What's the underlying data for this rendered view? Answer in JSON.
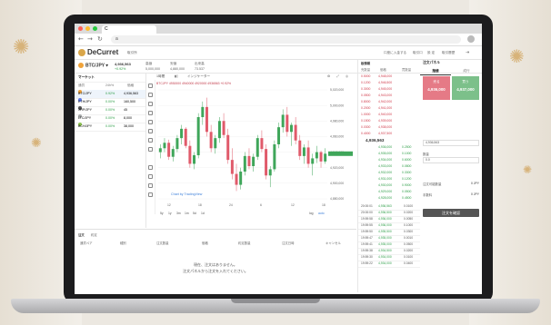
{
  "browser": {
    "tab_title": "C",
    "url": "a"
  },
  "app": {
    "logo": "DeCurret",
    "header_tag": "取引所",
    "header_right": [
      "口座に入金する",
      "取引口",
      "設 定",
      "取引履歴"
    ]
  },
  "ticker": {
    "pair": "BTC/JPY",
    "last_price": "4,936,563",
    "change_pct": "+0.92%",
    "high": "5,000,000",
    "low": "4,880,000",
    "volume": "73.537"
  },
  "left_panel": {
    "title": "マーケット",
    "headers": [
      "通貨",
      "24h%",
      "価格"
    ],
    "rows": [
      {
        "pair": "BTC/JPY",
        "change": "0.92%",
        "price": "4,936,563",
        "color": "#f0a33a"
      },
      {
        "pair": "ETH/JPY",
        "change": "0.00%",
        "price": "160,500",
        "color": "#627eea"
      },
      {
        "pair": "XRP/JPY",
        "change": "0.00%",
        "price": "45",
        "color": "#555555"
      },
      {
        "pair": "LTC/JPY",
        "change": "0.00%",
        "price": "8,000",
        "color": "#a6a9aa"
      },
      {
        "pair": "BCH/JPY",
        "change": "0.00%",
        "price": "38,000",
        "color": "#8dc351"
      }
    ]
  },
  "chart": {
    "interval_label": "1時間",
    "indicator_label": "インジケーター",
    "ohlc_text": "BTCJPY 4930000 4940000 4920000 4936563 +0.92%",
    "watermark": "Chart by TradingView",
    "time_ranges": [
      "5y",
      "1y",
      "3m",
      "1m",
      "5d",
      "1d"
    ],
    "log_label": "log",
    "auto_label": "auto",
    "time_ticks": [
      "12",
      "18",
      "24",
      "6",
      "12",
      "18"
    ],
    "price_ticks": [
      "5,020,000",
      "5,000,000",
      "4,980,000",
      "4,960,000",
      "4,940,000",
      "4,920,000",
      "4,900,000",
      "4,880,000"
    ]
  },
  "chart_data": {
    "type": "candlestick",
    "title": "",
    "ylim": [
      4880000,
      5020000
    ],
    "candles": [
      [
        4940000,
        4950000,
        4932000,
        4945000
      ],
      [
        4945000,
        4958000,
        4940000,
        4952000
      ],
      [
        4952000,
        4956000,
        4930000,
        4934000
      ],
      [
        4934000,
        4948000,
        4928000,
        4944000
      ],
      [
        4944000,
        4962000,
        4940000,
        4958000
      ],
      [
        4958000,
        4975000,
        4950000,
        4970000
      ],
      [
        4970000,
        4972000,
        4945000,
        4948000
      ],
      [
        4948000,
        4955000,
        4920000,
        4925000
      ],
      [
        4925000,
        4940000,
        4918000,
        4936000
      ],
      [
        4936000,
        4990000,
        4932000,
        4985000
      ],
      [
        4985000,
        5005000,
        4975000,
        4998000
      ],
      [
        4998000,
        5010000,
        4960000,
        4966000
      ],
      [
        4966000,
        4975000,
        4940000,
        4945000
      ],
      [
        4945000,
        4962000,
        4938000,
        4958000
      ],
      [
        4958000,
        4985000,
        4952000,
        4980000
      ],
      [
        4980000,
        4990000,
        4958000,
        4962000
      ],
      [
        4962000,
        4970000,
        4925000,
        4930000
      ],
      [
        4930000,
        4945000,
        4905000,
        4912000
      ],
      [
        4912000,
        4925000,
        4890000,
        4898000
      ],
      [
        4898000,
        4920000,
        4892000,
        4915000
      ],
      [
        4915000,
        4940000,
        4910000,
        4935000
      ],
      [
        4935000,
        4945000,
        4918000,
        4922000
      ],
      [
        4922000,
        4938000,
        4915000,
        4934000
      ],
      [
        4934000,
        4962000,
        4930000,
        4958000
      ],
      [
        4958000,
        4968000,
        4940000,
        4944000
      ],
      [
        4944000,
        4950000,
        4905000,
        4910000
      ],
      [
        4910000,
        4922000,
        4895000,
        4918000
      ],
      [
        4918000,
        4955000,
        4915000,
        4950000
      ],
      [
        4950000,
        4978000,
        4945000,
        4972000
      ],
      [
        4972000,
        4995000,
        4965000,
        4988000
      ],
      [
        4988000,
        4998000,
        4960000,
        4966000
      ],
      [
        4966000,
        4978000,
        4948000,
        4975000
      ],
      [
        4975000,
        4985000,
        4950000,
        4955000
      ],
      [
        4955000,
        4962000,
        4930000,
        4935000
      ],
      [
        4935000,
        4950000,
        4925000,
        4946000
      ],
      [
        4946000,
        4955000,
        4920000,
        4925000
      ],
      [
        4925000,
        4938000,
        4910000,
        4932000
      ],
      [
        4932000,
        4948000,
        4926000,
        4940000
      ],
      [
        4940000,
        4942000,
        4920000,
        4928000
      ],
      [
        4928000,
        4945000,
        4925000,
        4938000
      ]
    ]
  },
  "orderbook": {
    "title": "板情報",
    "headers": [
      "売数量",
      "価格",
      "買数量"
    ],
    "asks": [
      {
        "qty": "0.5000",
        "price": "4,948,000"
      },
      {
        "qty": "0.1200",
        "price": "4,946,500"
      },
      {
        "qty": "0.3000",
        "price": "4,945,000"
      },
      {
        "qty": "0.0500",
        "price": "4,943,000"
      },
      {
        "qty": "0.8000",
        "price": "4,942,000"
      },
      {
        "qty": "0.2000",
        "price": "4,941,000"
      },
      {
        "qty": "1.0000",
        "price": "4,940,000"
      },
      {
        "qty": "0.1500",
        "price": "4,939,000"
      },
      {
        "qty": "0.0300",
        "price": "4,938,000"
      },
      {
        "qty": "0.4000",
        "price": "4,937,500"
      }
    ],
    "mid_price": "4,936,563",
    "bids": [
      {
        "qty": "0.2500",
        "price": "4,936,000"
      },
      {
        "qty": "0.1000",
        "price": "4,935,000"
      },
      {
        "qty": "0.6000",
        "price": "4,934,000"
      },
      {
        "qty": "0.0800",
        "price": "4,933,000"
      },
      {
        "qty": "0.3300",
        "price": "4,932,000"
      },
      {
        "qty": "0.1200",
        "price": "4,931,000"
      },
      {
        "qty": "0.9000",
        "price": "4,930,000"
      },
      {
        "qty": "0.0500",
        "price": "4,929,000"
      },
      {
        "qty": "0.4500",
        "price": "4,928,000"
      }
    ]
  },
  "trades": [
    {
      "time": "20:00:01",
      "price": "4,936,563",
      "qty": "0.0100"
    },
    {
      "time": "20:00:00",
      "price": "4,936,500",
      "qty": "0.0200"
    },
    {
      "time": "19:59:58",
      "price": "4,936,000",
      "qty": "0.0050"
    },
    {
      "time": "19:59:55",
      "price": "4,936,000",
      "qty": "0.1000"
    },
    {
      "time": "19:59:50",
      "price": "4,935,500",
      "qty": "0.0300"
    },
    {
      "time": "19:59:47",
      "price": "4,935,000",
      "qty": "0.0010"
    },
    {
      "time": "19:59:41",
      "price": "4,935,000",
      "qty": "0.0500"
    },
    {
      "time": "19:59:38",
      "price": "4,934,500",
      "qty": "0.0200"
    },
    {
      "time": "19:59:30",
      "price": "4,934,000",
      "qty": "0.0100"
    },
    {
      "time": "19:59:22",
      "price": "4,934,000",
      "qty": "0.0400"
    }
  ],
  "order_form": {
    "title": "注文パネル",
    "tab_limit": "指値",
    "tab_market": "成行",
    "sell_label": "売る",
    "sell_price": "4,936,000",
    "buy_label": "買う",
    "buy_price": "4,937,000",
    "price_input": "4,936,563",
    "qty_label": "数量",
    "qty_value": "0.0",
    "avail_label": "注文可能数量",
    "avail_value": "0 JPY",
    "fee_label": "手数料",
    "fee_value": "0 JPY",
    "submit": "注文を確認"
  },
  "bottom_panel": {
    "tabs": [
      "注文",
      "約定"
    ],
    "headers": [
      "通貨ペア",
      "種別",
      "注文数量",
      "価格",
      "約定数量",
      "注文日時",
      "キャンセル"
    ],
    "empty_line1": "現在、注文はありません。",
    "empty_line2": "注文パネルから注文を入れてください。"
  },
  "colors": {
    "accent_gold": "#d9a64a",
    "ask_red": "#d03a4a",
    "bid_green": "#2e9e48",
    "candle_up": "#3fa65a",
    "candle_down": "#e05a6a"
  }
}
